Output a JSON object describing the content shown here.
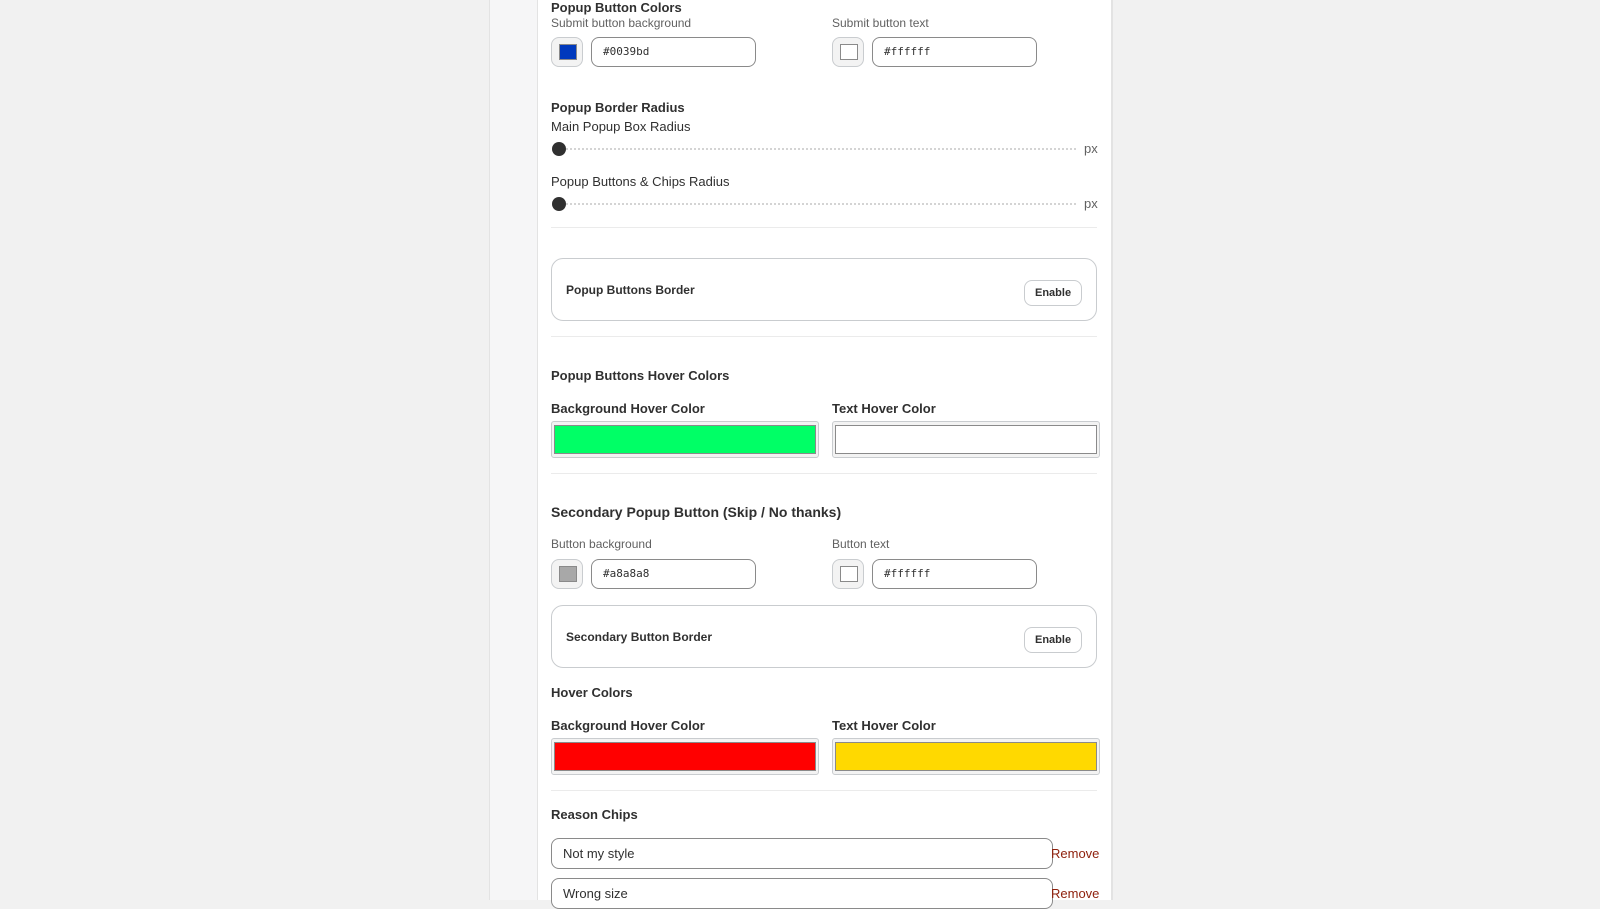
{
  "popup_button_colors": {
    "title": "Popup Button Colors",
    "submit_bg_label": "Submit button background",
    "submit_bg_value": "#0039bd",
    "submit_bg_color": "#0039bd",
    "submit_text_label": "Submit button text",
    "submit_text_value": "#ffffff",
    "submit_text_color": "#ffffff"
  },
  "border_radius": {
    "title": "Popup Border Radius",
    "main_label": "Main Popup Box Radius",
    "main_unit": "px",
    "main_value": 0,
    "chips_label": "Popup Buttons & Chips Radius",
    "chips_unit": "px",
    "chips_value": 0
  },
  "buttons_border": {
    "title": "Popup Buttons Border",
    "enable_label": "Enable"
  },
  "hover_colors": {
    "title": "Popup Buttons Hover Colors",
    "bg_label": "Background Hover Color",
    "bg_color": "#00ff66",
    "text_label": "Text Hover Color",
    "text_color": "#ffffff"
  },
  "secondary": {
    "title": "Secondary Popup Button (Skip / No thanks)",
    "bg_label": "Button background",
    "bg_value": "#a8a8a8",
    "bg_color": "#a8a8a8",
    "text_label": "Button text",
    "text_value": "#ffffff",
    "text_color": "#ffffff",
    "border_title": "Secondary Button Border",
    "border_enable_label": "Enable",
    "hover_title": "Hover Colors",
    "hover_bg_label": "Background Hover Color",
    "hover_bg_color": "#ff0000",
    "hover_text_label": "Text Hover Color",
    "hover_text_color": "#ffd900"
  },
  "reason_chips": {
    "title": "Reason Chips",
    "chips": [
      {
        "value": "Not my style",
        "remove_label": "Remove"
      },
      {
        "value": "Wrong size",
        "remove_label": "Remove"
      }
    ]
  }
}
